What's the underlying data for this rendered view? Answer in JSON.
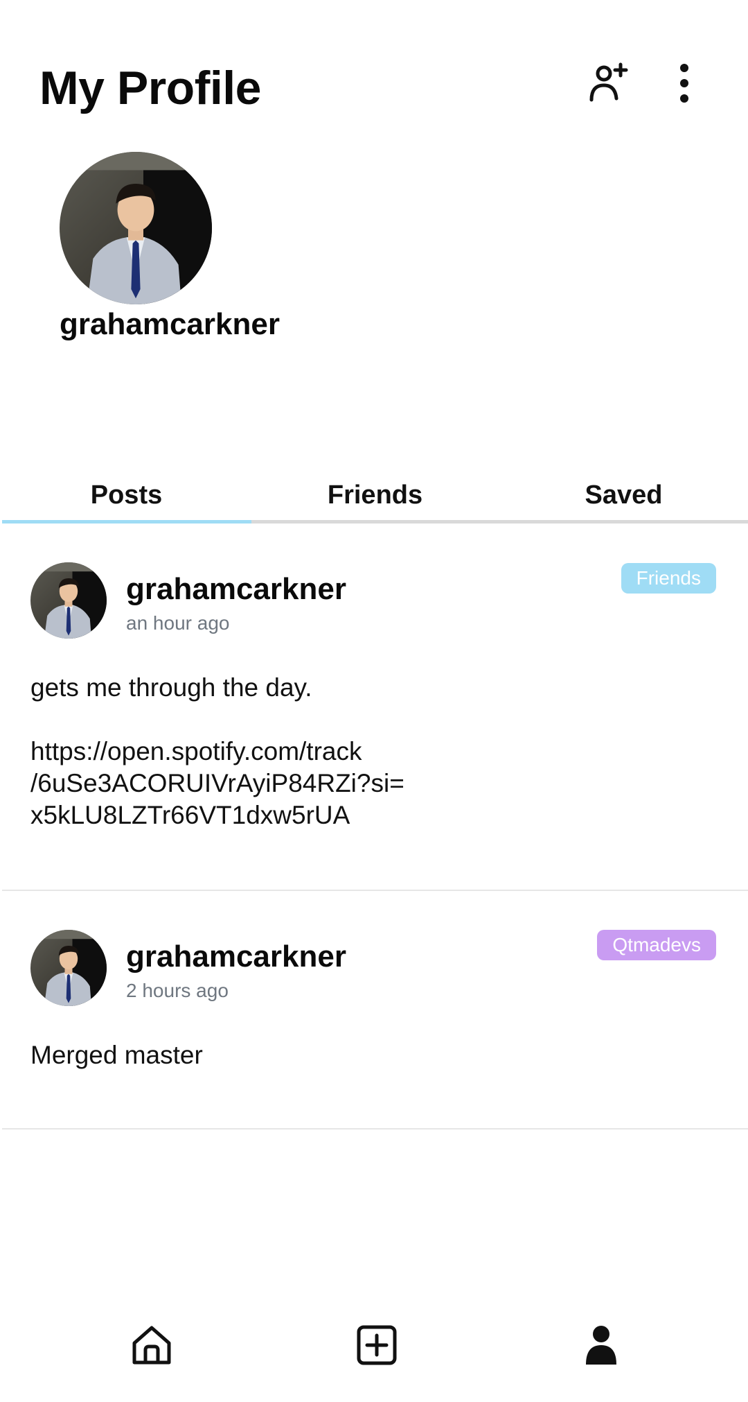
{
  "header": {
    "title": "My Profile",
    "add_friend_icon": "person-add-icon",
    "more_icon": "more-vertical-icon"
  },
  "profile": {
    "username": "grahamcarkner"
  },
  "tabs": [
    {
      "label": "Posts",
      "active": true
    },
    {
      "label": "Friends",
      "active": false
    },
    {
      "label": "Saved",
      "active": false
    }
  ],
  "colors": {
    "tab_indicator": "#9fdcf5",
    "badge_friends": "#9fdcf5",
    "badge_qtmadevs": "#c99cf2"
  },
  "posts": [
    {
      "author": "grahamcarkner",
      "time": "an hour ago",
      "badge": "Friends",
      "body_line1": "gets me through the day.",
      "body_line2": "https://open.spotify.com/track\n/6uSe3ACORUIVrAyiP84RZi?si=\nx5kLU8LZTr66VT1dxw5rUA"
    },
    {
      "author": "grahamcarkner",
      "time": "2 hours ago",
      "badge": "Qtmadevs",
      "body_line1": "Merged master"
    }
  ],
  "bottom_nav": [
    {
      "icon": "home-icon"
    },
    {
      "icon": "add-post-icon"
    },
    {
      "icon": "profile-icon"
    }
  ]
}
